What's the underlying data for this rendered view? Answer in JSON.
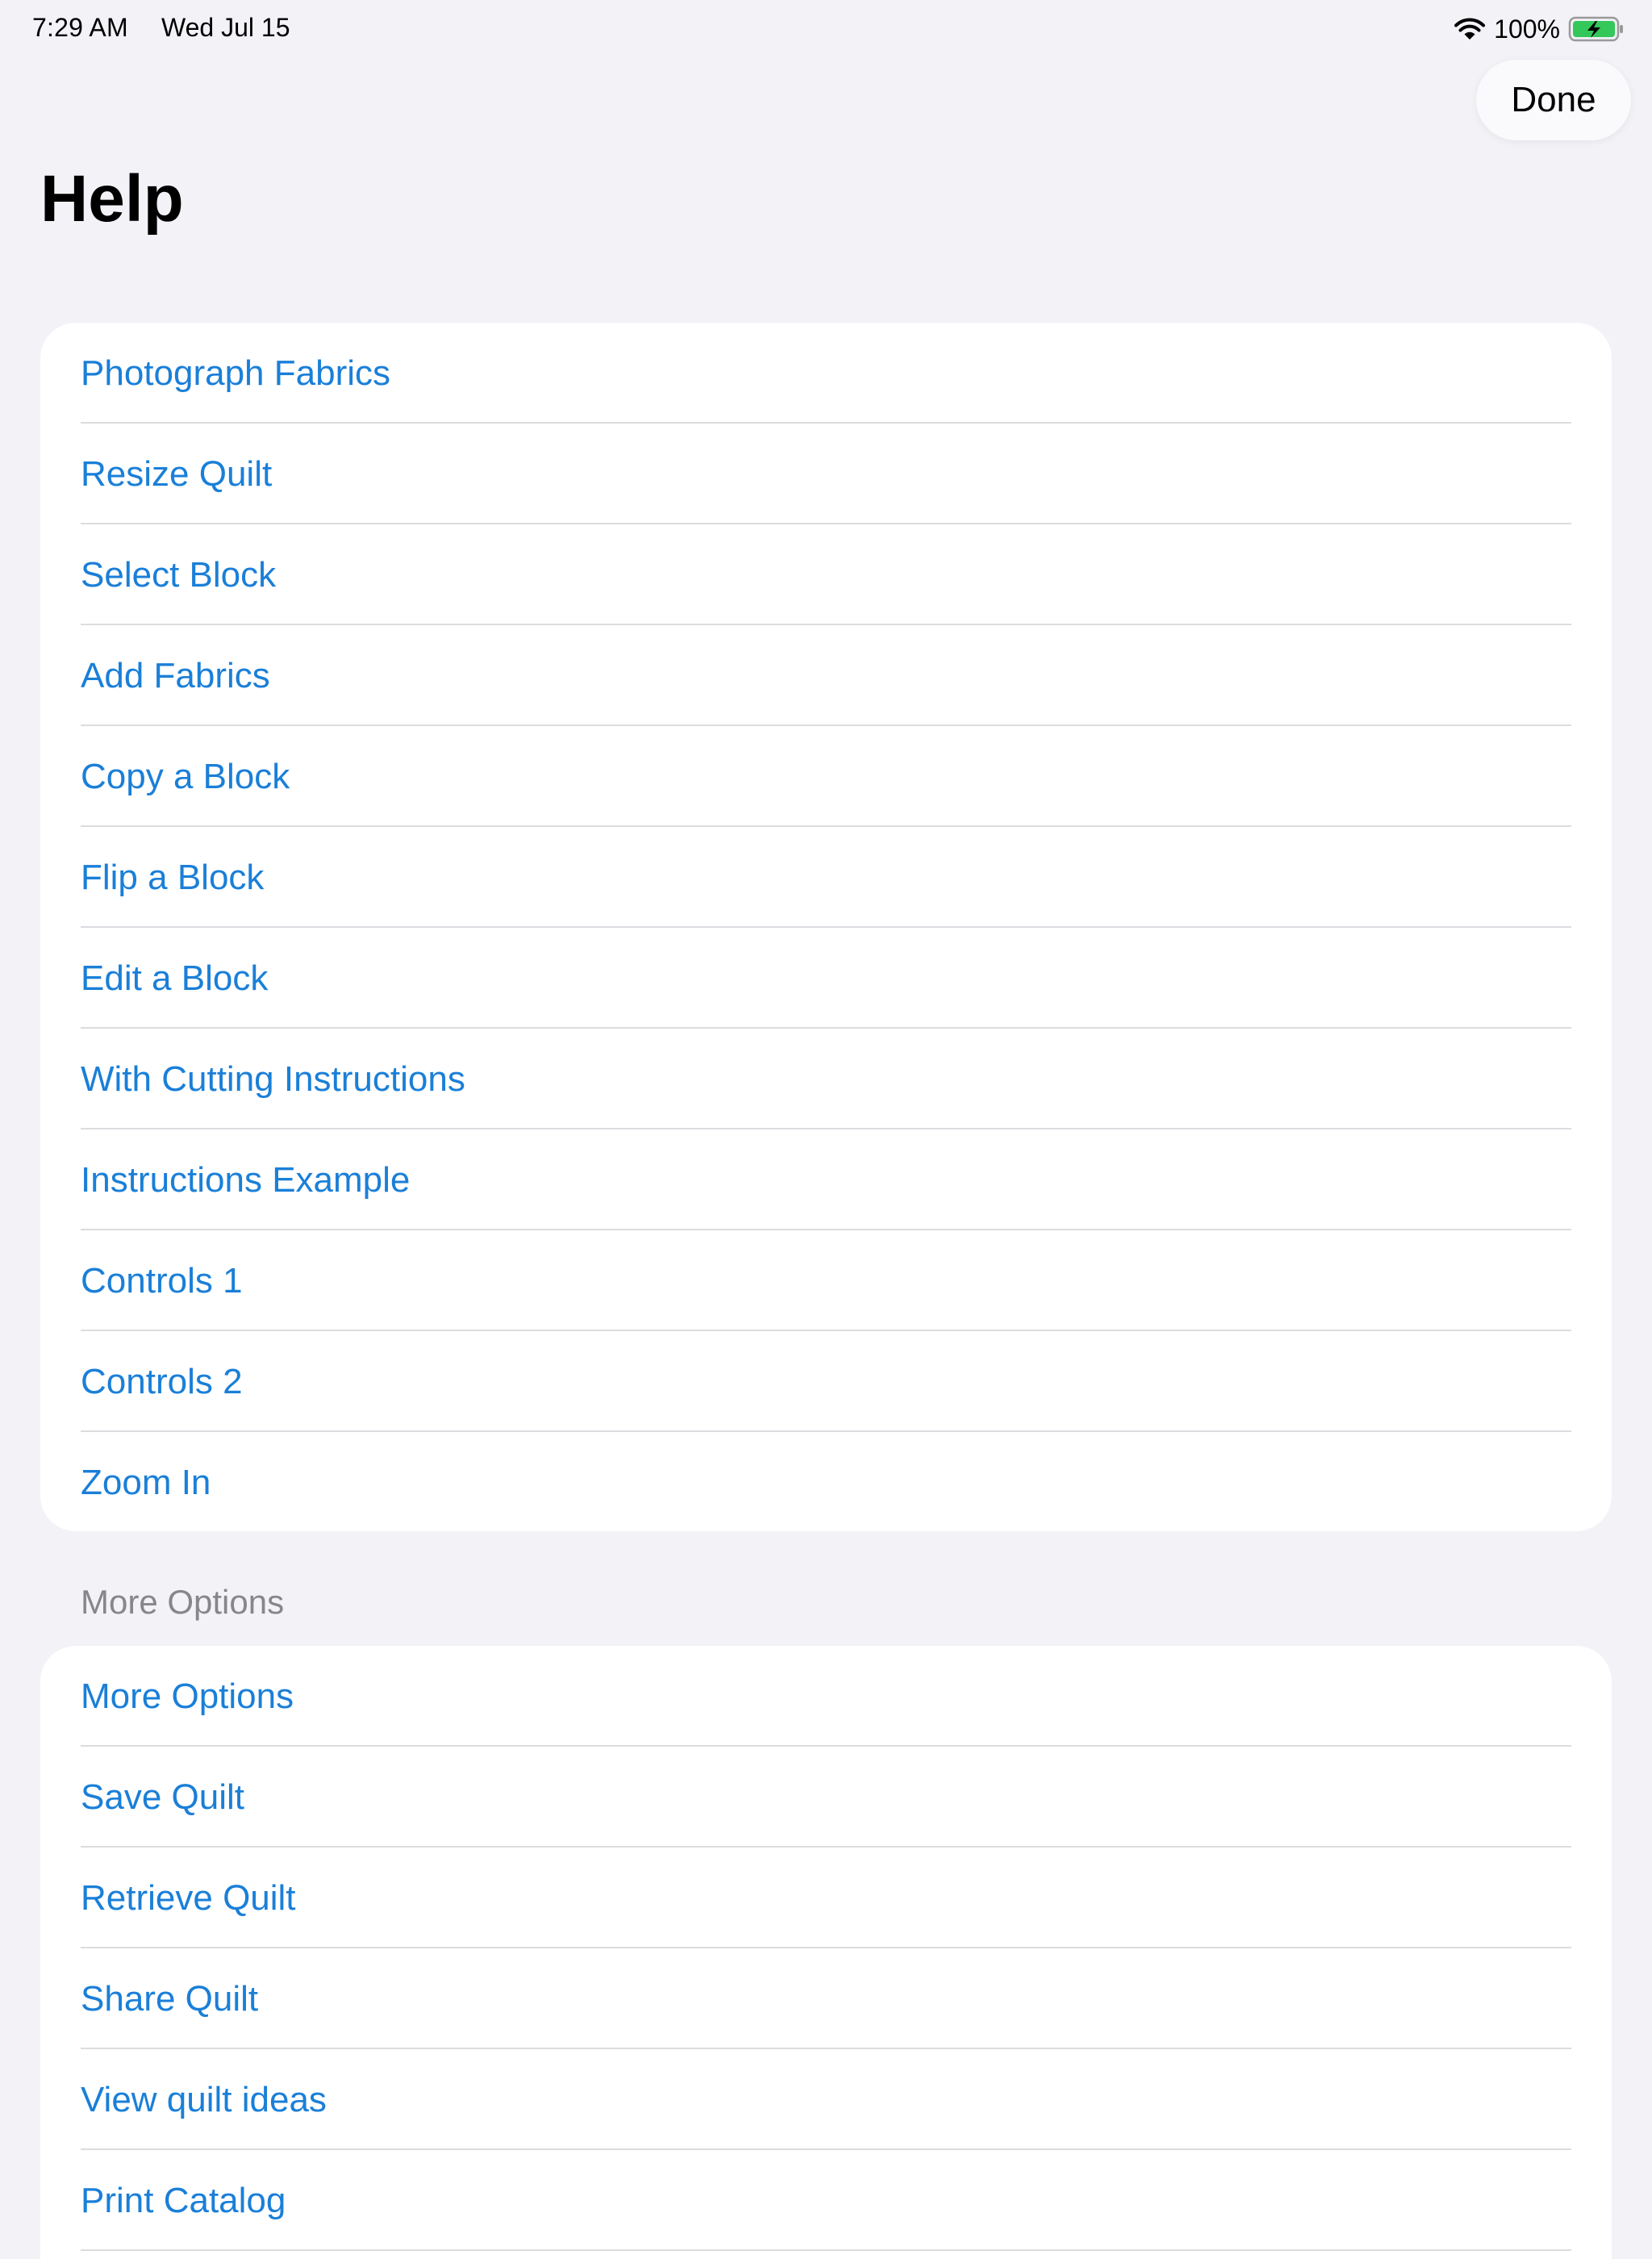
{
  "status_bar": {
    "time": "7:29 AM",
    "date": "Wed Jul 15",
    "battery_percent": "100%",
    "wifi_icon": "wifi-icon",
    "battery_icon": "battery-charging-icon",
    "battery_color": "#34c759"
  },
  "nav": {
    "done_label": "Done",
    "title": "Help"
  },
  "help_items": [
    {
      "label": "Photograph Fabrics"
    },
    {
      "label": "Resize Quilt"
    },
    {
      "label": "Select Block"
    },
    {
      "label": "Add Fabrics"
    },
    {
      "label": "Copy a Block"
    },
    {
      "label": "Flip a Block"
    },
    {
      "label": "Edit a Block"
    },
    {
      "label": "With Cutting Instructions"
    },
    {
      "label": "Instructions Example"
    },
    {
      "label": "Controls 1"
    },
    {
      "label": "Controls 2"
    },
    {
      "label": "Zoom In"
    }
  ],
  "more_options": {
    "header": "More Options",
    "items": [
      {
        "label": "More Options"
      },
      {
        "label": "Save Quilt"
      },
      {
        "label": "Retrieve Quilt"
      },
      {
        "label": "Share Quilt"
      },
      {
        "label": "View quilt ideas"
      },
      {
        "label": "Print Catalog"
      }
    ]
  },
  "colors": {
    "background": "#f2f2f7",
    "link": "#1a7fd8",
    "section_header": "#86868b"
  }
}
